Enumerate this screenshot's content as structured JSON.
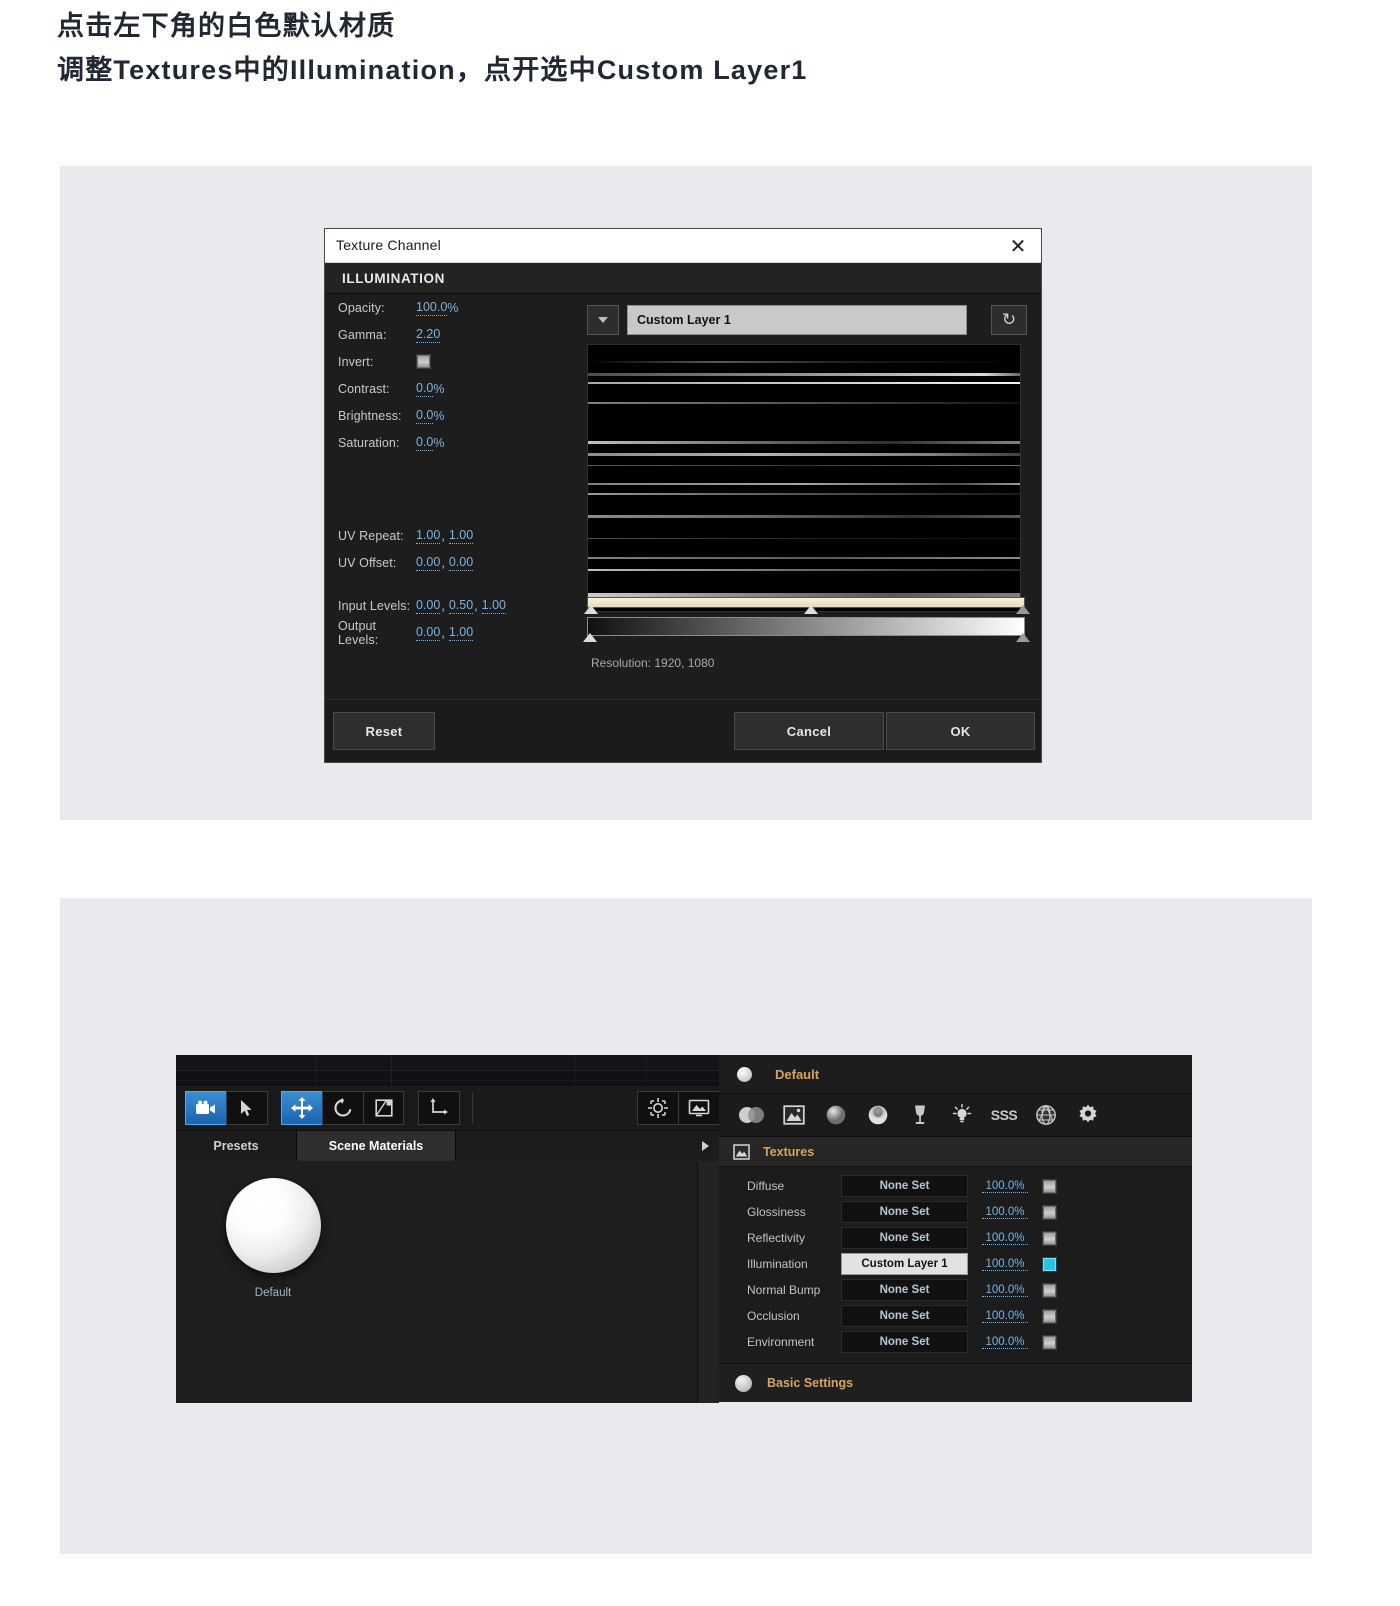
{
  "heading": {
    "line1": "点击左下角的白色默认材质",
    "line2": "调整Textures中的Illumination，点开选中Custom Layer1"
  },
  "dialog": {
    "title": "Texture Channel",
    "close_label": "✕",
    "section_title": "ILLUMINATION",
    "params": [
      {
        "label": "Opacity:",
        "value": "100.0",
        "suffix": "%"
      },
      {
        "label": "Gamma:",
        "value": "2.20",
        "suffix": ""
      },
      {
        "label": "Invert:",
        "value": "",
        "suffix": ""
      },
      {
        "label": "Contrast:",
        "value": "0.0",
        "suffix": "%"
      },
      {
        "label": "Brightness:",
        "value": "0.0",
        "suffix": "%"
      },
      {
        "label": "Saturation:",
        "value": "0.0",
        "suffix": "%"
      }
    ],
    "uv_repeat": {
      "label": "UV Repeat:",
      "u": "1.00",
      "v": "1.00"
    },
    "uv_offset": {
      "label": "UV Offset:",
      "u": "0.00",
      "v": "0.00"
    },
    "input_levels": {
      "label": "Input Levels:",
      "black": "0.00",
      "mid": "0.50",
      "white": "1.00"
    },
    "output_levels": {
      "label": "Output Levels:",
      "black": "0.00",
      "white": "1.00"
    },
    "layer_name": "Custom Layer 1",
    "refresh_icon": "↻",
    "resolution": "Resolution: 1920, 1080",
    "buttons": {
      "reset": "Reset",
      "cancel": "Cancel",
      "ok": "OK"
    }
  },
  "editor": {
    "tabs": [
      {
        "label": "Presets",
        "active": false
      },
      {
        "label": "Scene Materials",
        "active": true
      }
    ],
    "swatch": {
      "label": "Default"
    },
    "material": {
      "name": "Default"
    },
    "textures_section": {
      "label": "Textures"
    },
    "basic_section": {
      "label": "Basic Settings"
    },
    "texture_rows": [
      {
        "label": "Diffuse",
        "map": "None Set",
        "amount": "100.0%",
        "enabled": false
      },
      {
        "label": "Glossiness",
        "map": "None Set",
        "amount": "100.0%",
        "enabled": false
      },
      {
        "label": "Reflectivity",
        "map": "None Set",
        "amount": "100.0%",
        "enabled": false
      },
      {
        "label": "Illumination",
        "map": "Custom Layer 1",
        "amount": "100.0%",
        "enabled": true
      },
      {
        "label": "Normal Bump",
        "map": "None Set",
        "amount": "100.0%",
        "enabled": false
      },
      {
        "label": "Occlusion",
        "map": "None Set",
        "amount": "100.0%",
        "enabled": false
      },
      {
        "label": "Environment",
        "map": "None Set",
        "amount": "100.0%",
        "enabled": false
      }
    ]
  },
  "colors": {
    "accent_blue": "#79b4e0",
    "orange_label": "#d7a45f",
    "active_tool": "#2d7ec4",
    "enabled_checkbox": "#25c3e6",
    "panel_bg": "#1c1c1c",
    "figure_bg": "#e8eaee"
  }
}
